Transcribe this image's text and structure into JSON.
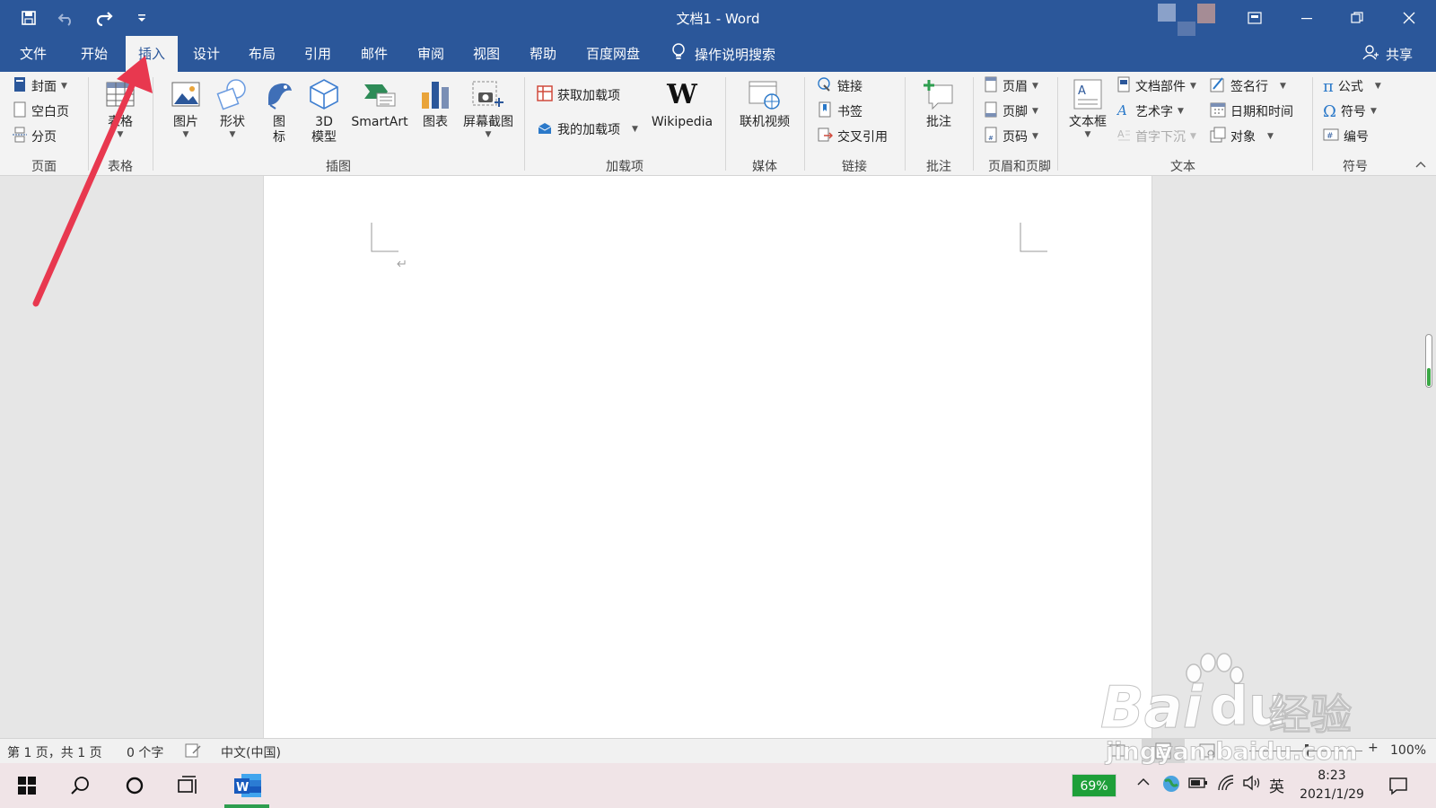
{
  "title_bar": {
    "title": "文档1  -  Word"
  },
  "tabs": [
    "文件",
    "开始",
    "插入",
    "设计",
    "布局",
    "引用",
    "邮件",
    "审阅",
    "视图",
    "帮助",
    "百度网盘"
  ],
  "active_tab": "插入",
  "search": {
    "label": "操作说明搜索"
  },
  "share": {
    "label": "共享"
  },
  "ribbon": {
    "pages": {
      "cover": "封面",
      "blank": "空白页",
      "break": "分页",
      "group": "页面"
    },
    "tables": {
      "table": "表格",
      "group": "表格"
    },
    "illustrations": {
      "picture": "图片",
      "shapes": "形状",
      "icons_1": "图",
      "icons_2": "标",
      "model_1": "3D",
      "model_2": "模型",
      "smartart": "SmartArt",
      "chart": "图表",
      "screenshot": "屏幕截图",
      "group": "插图"
    },
    "addins": {
      "get": "获取加载项",
      "mine": "我的加载项",
      "wikipedia": "Wikipedia",
      "wiki_glyph": "W",
      "group": "加载项"
    },
    "media": {
      "video": "联机视频",
      "group": "媒体"
    },
    "links": {
      "link": "链接",
      "bookmark": "书签",
      "crossref": "交叉引用",
      "group": "链接"
    },
    "comments": {
      "comment": "批注",
      "group": "批注"
    },
    "header_footer": {
      "header": "页眉",
      "footer": "页脚",
      "page_number": "页码",
      "group": "页眉和页脚"
    },
    "text": {
      "textbox": "文本框",
      "quickparts": "文档部件",
      "wordart": "艺术字",
      "dropcap": "首字下沉",
      "signature": "签名行",
      "datetime": "日期和时间",
      "object": "对象",
      "group": "文本"
    },
    "symbols": {
      "equation": "公式",
      "symbol": "符号",
      "numbering": "编号",
      "group": "符号",
      "pi": "π",
      "omega": "Ω"
    }
  },
  "status_bar": {
    "page": "第 1 页，共 1 页",
    "words": "0 个字",
    "language": "中文(中国)",
    "zoom": "100%"
  },
  "taskbar": {
    "battery": "69%",
    "ime": "英",
    "time": "8:23",
    "date": "2021/1/29"
  },
  "watermark": {
    "brand": "Bai",
    "brand2": "du",
    "cn": "经验",
    "url": "jingyan.baidu.com"
  },
  "colors": {
    "accent": "#2b579a",
    "arrow": "#e8384f",
    "battery": "#1e9f39"
  }
}
